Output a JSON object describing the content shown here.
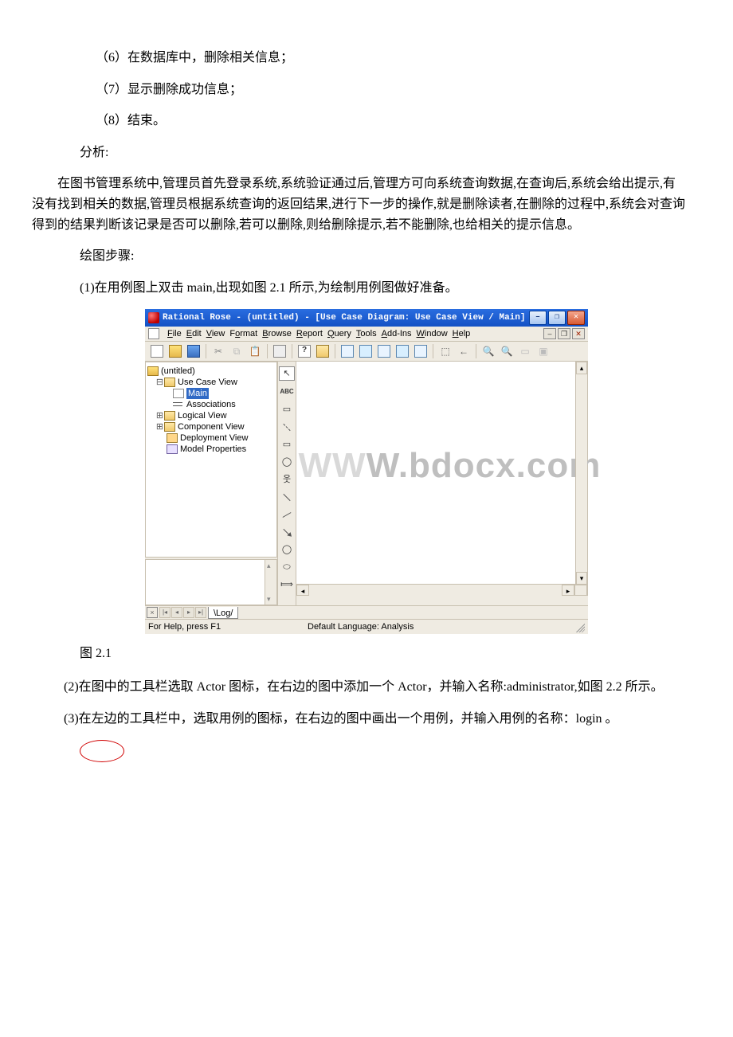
{
  "body": {
    "line1": "（6）在数据库中，删除相关信息；",
    "line2": "（7）显示删除成功信息；",
    "line3": "（8）结束。",
    "analysis_label": "分析:",
    "analysis_text": "在图书管理系统中,管理员首先登录系统,系统验证通过后,管理方可向系统查询数据,在查询后,系统会给出提示,有没有找到相关的数据,管理员根据系统查询的返回结果,进行下一步的操作,就是删除读者,在删除的过程中,系统会对查询得到的结果判断该记录是否可以删除,若可以删除,则给删除提示,若不能删除,也给相关的提示信息。",
    "draw_label": "绘图步骤:",
    "step1": "(1)在用例图上双击 main,出现如图 2.1 所示,为绘制用例图做好准备。",
    "caption": "图 2.1",
    "step2": "(2)在图中的工具栏选取 Actor 图标，在右边的图中添加一个 Actor，并输入名称:administrator,如图 2.2 所示。",
    "step3": "(3)在左边的工具栏中，选取用例的图标，在右边的图中画出一个用例，并输入用例的名称：login 。"
  },
  "screenshot": {
    "title": "Rational Rose - (untitled) - [Use Case Diagram: Use Case View / Main]",
    "menus": {
      "file": "File",
      "edit": "Edit",
      "view": "View",
      "format": "Format",
      "browse": "Browse",
      "report": "Report",
      "query": "Query",
      "tools": "Tools",
      "addins": "Add-Ins",
      "window": "Window",
      "help": "Help"
    },
    "tree": {
      "root": "(untitled)",
      "usecase": "Use Case View",
      "main": "Main",
      "assoc": "Associations",
      "logical": "Logical View",
      "component": "Component View",
      "deployment": "Deployment View",
      "model": "Model Properties"
    },
    "palette": {
      "pointer": "↖",
      "text": "ABC",
      "note": "▭",
      "anchor": "line",
      "pkg": "▭",
      "usecase": "◯",
      "actor": "웃",
      "assoc": "↗",
      "dep": "↗",
      "gen": "⟶",
      "uc2": "◯",
      "uc3": "⬭",
      "uc4": "⟾"
    },
    "log_tab": "\\Log/",
    "status_left": "For Help, press F1",
    "status_center": "Default Language: Analysis",
    "watermark_a": "WW",
    "watermark_b": "W.",
    "watermark_c": "bdocx.com"
  }
}
